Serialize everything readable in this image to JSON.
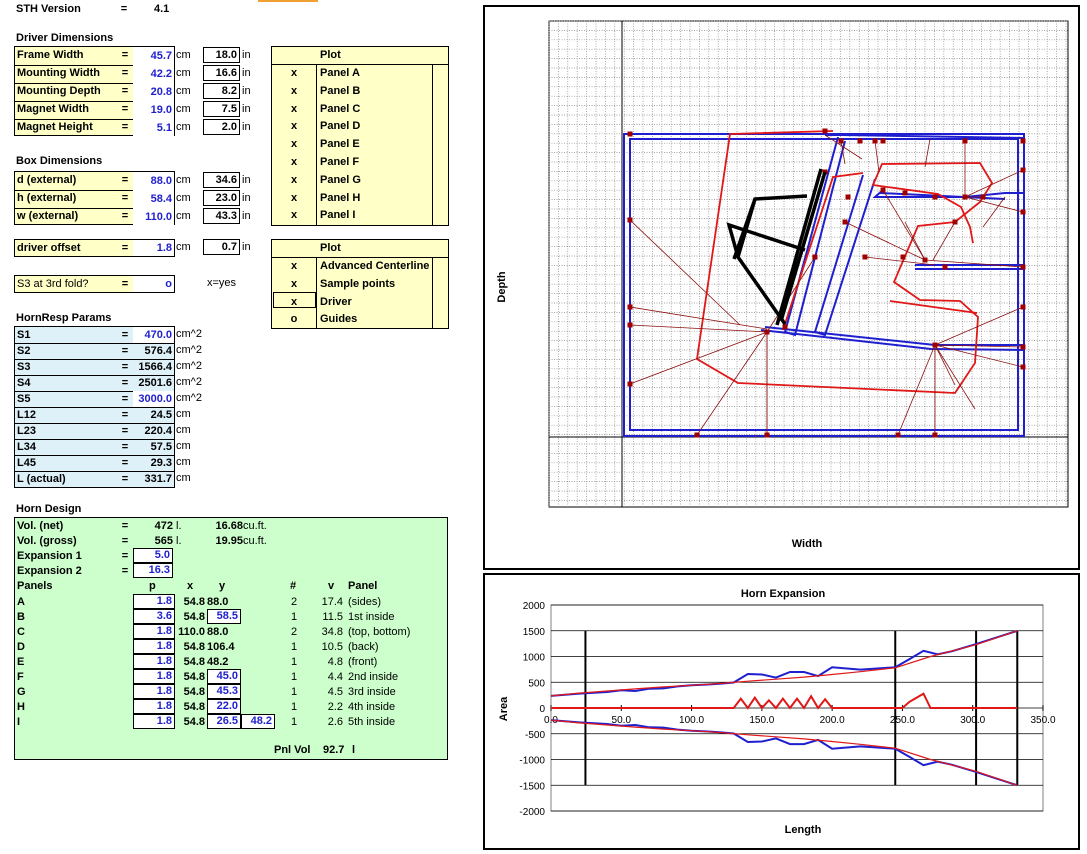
{
  "version": {
    "label": "STH Version",
    "eq": "=",
    "value": "4.1"
  },
  "driver": {
    "heading": "Driver Dimensions",
    "rows": [
      {
        "label": "Frame Width",
        "cm": "45.7",
        "in": "18.0"
      },
      {
        "label": "Mounting Width",
        "cm": "42.2",
        "in": "16.6"
      },
      {
        "label": "Mounting Depth",
        "cm": "20.8",
        "in": "8.2"
      },
      {
        "label": "Magnet Width",
        "cm": "19.0",
        "in": "7.5"
      },
      {
        "label": "Magnet Height",
        "cm": "5.1",
        "in": "2.0"
      }
    ]
  },
  "box": {
    "heading": "Box Dimensions",
    "rows": [
      {
        "label": "d (external)",
        "cm": "88.0",
        "in": "34.6"
      },
      {
        "label": "h (external)",
        "cm": "58.4",
        "in": "23.0"
      },
      {
        "label": "w (external)",
        "cm": "110.0",
        "in": "43.3"
      }
    ]
  },
  "offset": {
    "label": "driver offset",
    "cm": "1.8",
    "in": "0.7"
  },
  "s3": {
    "label": "S3 at 3rd fold?",
    "value": "o",
    "hint": "x=yes"
  },
  "units": {
    "cm": "cm",
    "in": "in",
    "eq": "=",
    "cm2": "cm^2"
  },
  "plot1": {
    "header": "Plot",
    "rows": [
      {
        "mark": "x",
        "label": "Panel A"
      },
      {
        "mark": "x",
        "label": "Panel B"
      },
      {
        "mark": "x",
        "label": "Panel C"
      },
      {
        "mark": "x",
        "label": "Panel D"
      },
      {
        "mark": "x",
        "label": "Panel E"
      },
      {
        "mark": "x",
        "label": "Panel F"
      },
      {
        "mark": "x",
        "label": "Panel G"
      },
      {
        "mark": "x",
        "label": "Panel H"
      },
      {
        "mark": "x",
        "label": "Panel I"
      }
    ]
  },
  "plot2": {
    "header": "Plot",
    "rows": [
      {
        "mark": "x",
        "label": "Advanced Centerline"
      },
      {
        "mark": "x",
        "label": "Sample points"
      },
      {
        "mark": "x",
        "label": "Driver"
      },
      {
        "mark": "o",
        "label": "Guides"
      }
    ]
  },
  "hornresp": {
    "heading": "HornResp Params",
    "rows": [
      {
        "label": "S1",
        "value": "470.0",
        "unit": "cm^2",
        "blue": true
      },
      {
        "label": "S2",
        "value": "576.4",
        "unit": "cm^2",
        "blue": false
      },
      {
        "label": "S3",
        "value": "1566.4",
        "unit": "cm^2",
        "blue": false
      },
      {
        "label": "S4",
        "value": "2501.6",
        "unit": "cm^2",
        "blue": false
      },
      {
        "label": "S5",
        "value": "3000.0",
        "unit": "cm^2",
        "blue": true
      },
      {
        "label": "L12",
        "value": "24.5",
        "unit": "cm",
        "blue": false
      },
      {
        "label": "L23",
        "value": "220.4",
        "unit": "cm",
        "blue": false
      },
      {
        "label": "L34",
        "value": "57.5",
        "unit": "cm",
        "blue": false
      },
      {
        "label": "L45",
        "value": "29.3",
        "unit": "cm",
        "blue": false
      },
      {
        "label": "L (actual)",
        "value": "331.7",
        "unit": "cm",
        "blue": false
      }
    ]
  },
  "horn": {
    "heading": "Horn Design",
    "vol_net": {
      "label": "Vol. (net)",
      "value": "472",
      "unit": "l.",
      "cuft": "16.68",
      "cuft_unit": "cu.ft."
    },
    "vol_gross": {
      "label": "Vol. (gross)",
      "value": "565",
      "unit": "l.",
      "cuft": "19.95",
      "cuft_unit": "cu.ft."
    },
    "exp1": {
      "label": "Expansion 1",
      "value": "5.0"
    },
    "exp2": {
      "label": "Expansion 2",
      "value": "16.3"
    },
    "cols": {
      "panels": "Panels",
      "p": "p",
      "x": "x",
      "y": "y",
      "n": "#",
      "v": "v",
      "panel": "Panel"
    },
    "panels": [
      {
        "name": "A",
        "p": "1.8",
        "x": "54.8",
        "y": "88.0",
        "yb": false,
        "y2": "",
        "n": "2",
        "v": "17.4",
        "desc": "(sides)"
      },
      {
        "name": "B",
        "p": "3.6",
        "x": "54.8",
        "y": "58.5",
        "yb": true,
        "y2": "",
        "n": "1",
        "v": "11.5",
        "desc": "1st inside"
      },
      {
        "name": "C",
        "p": "1.8",
        "x": "110.0",
        "y": "88.0",
        "yb": false,
        "y2": "",
        "n": "2",
        "v": "34.8",
        "desc": "(top, bottom)"
      },
      {
        "name": "D",
        "p": "1.8",
        "x": "54.8",
        "y": "106.4",
        "yb": false,
        "y2": "",
        "n": "1",
        "v": "10.5",
        "desc": "(back)"
      },
      {
        "name": "E",
        "p": "1.8",
        "x": "54.8",
        "y": "48.2",
        "yb": false,
        "y2": "",
        "n": "1",
        "v": "4.8",
        "desc": "(front)"
      },
      {
        "name": "F",
        "p": "1.8",
        "x": "54.8",
        "y": "45.0",
        "yb": true,
        "y2": "",
        "n": "1",
        "v": "4.4",
        "desc": "2nd inside"
      },
      {
        "name": "G",
        "p": "1.8",
        "x": "54.8",
        "y": "45.3",
        "yb": true,
        "y2": "",
        "n": "1",
        "v": "4.5",
        "desc": "3rd inside"
      },
      {
        "name": "H",
        "p": "1.8",
        "x": "54.8",
        "y": "22.0",
        "yb": true,
        "y2": "",
        "n": "1",
        "v": "2.2",
        "desc": "4th inside"
      },
      {
        "name": "I",
        "p": "1.8",
        "x": "54.8",
        "y": "26.5",
        "yb": true,
        "y2": "48.2",
        "n": "1",
        "v": "2.6",
        "desc": "5th inside"
      }
    ],
    "pnl_vol": {
      "label": "Pnl Vol",
      "value": "92.7",
      "unit": "l"
    }
  },
  "layout_chart": {
    "xlabel": "Width",
    "ylabel": "Depth"
  },
  "colors": {
    "box_blue": "#1f1fd0",
    "red": "#e01818",
    "darkred": "#8b1010",
    "sheet_yellow": "#ffffc8",
    "sheet_cyan": "#dff1f8",
    "sheet_green": "#ccffcc"
  },
  "chart_data": {
    "type": "line",
    "title": "Horn Expansion",
    "xlabel": "Length",
    "ylabel": "Area",
    "xlim": [
      0,
      350
    ],
    "ylim": [
      -2000,
      2000
    ],
    "xticks": [
      "0.0",
      "50.0",
      "100.0",
      "150.0",
      "200.0",
      "250.0",
      "300.0",
      "350.0"
    ],
    "yticks": [
      "2000",
      "1500",
      "1000",
      "500",
      "0",
      "-500",
      "-1000",
      "-1500",
      "-2000"
    ],
    "fold_lines_x": [
      24.5,
      244.9,
      302.4,
      331.7
    ],
    "series": [
      {
        "color": "#1f1fd0",
        "x": [
          0,
          20,
          40,
          50,
          60,
          70,
          80,
          90,
          100,
          110,
          120,
          130,
          140,
          150,
          160,
          170,
          180,
          190,
          200,
          220,
          244.9,
          255,
          265,
          275,
          285,
          302.4,
          331.7
        ],
        "y": [
          235,
          280,
          310,
          345,
          330,
          375,
          380,
          420,
          440,
          455,
          470,
          495,
          660,
          650,
          590,
          700,
          700,
          620,
          790,
          745,
          790,
          950,
          1110,
          1040,
          1100,
          1240,
          1500
        ]
      },
      {
        "color": "#e01818",
        "x": [
          0,
          20,
          40,
          60,
          80,
          100,
          120,
          140,
          160,
          180,
          200,
          220,
          244.9,
          270,
          302.4,
          331.7
        ],
        "y": [
          235,
          290,
          330,
          370,
          410,
          440,
          475,
          520,
          560,
          600,
          650,
          705,
          780,
          1000,
          1230,
          1500
        ]
      },
      {
        "color": "#e01818",
        "x": [
          0,
          120,
          130,
          135,
          140,
          145,
          150,
          155,
          160,
          165,
          170,
          175,
          180,
          185,
          190,
          195,
          200,
          250,
          255,
          260,
          265,
          270,
          275,
          331.7
        ],
        "y": [
          0,
          0,
          0,
          180,
          0,
          200,
          0,
          150,
          0,
          180,
          0,
          180,
          0,
          230,
          0,
          170,
          0,
          0,
          120,
          200,
          280,
          0,
          0,
          0
        ]
      }
    ]
  }
}
